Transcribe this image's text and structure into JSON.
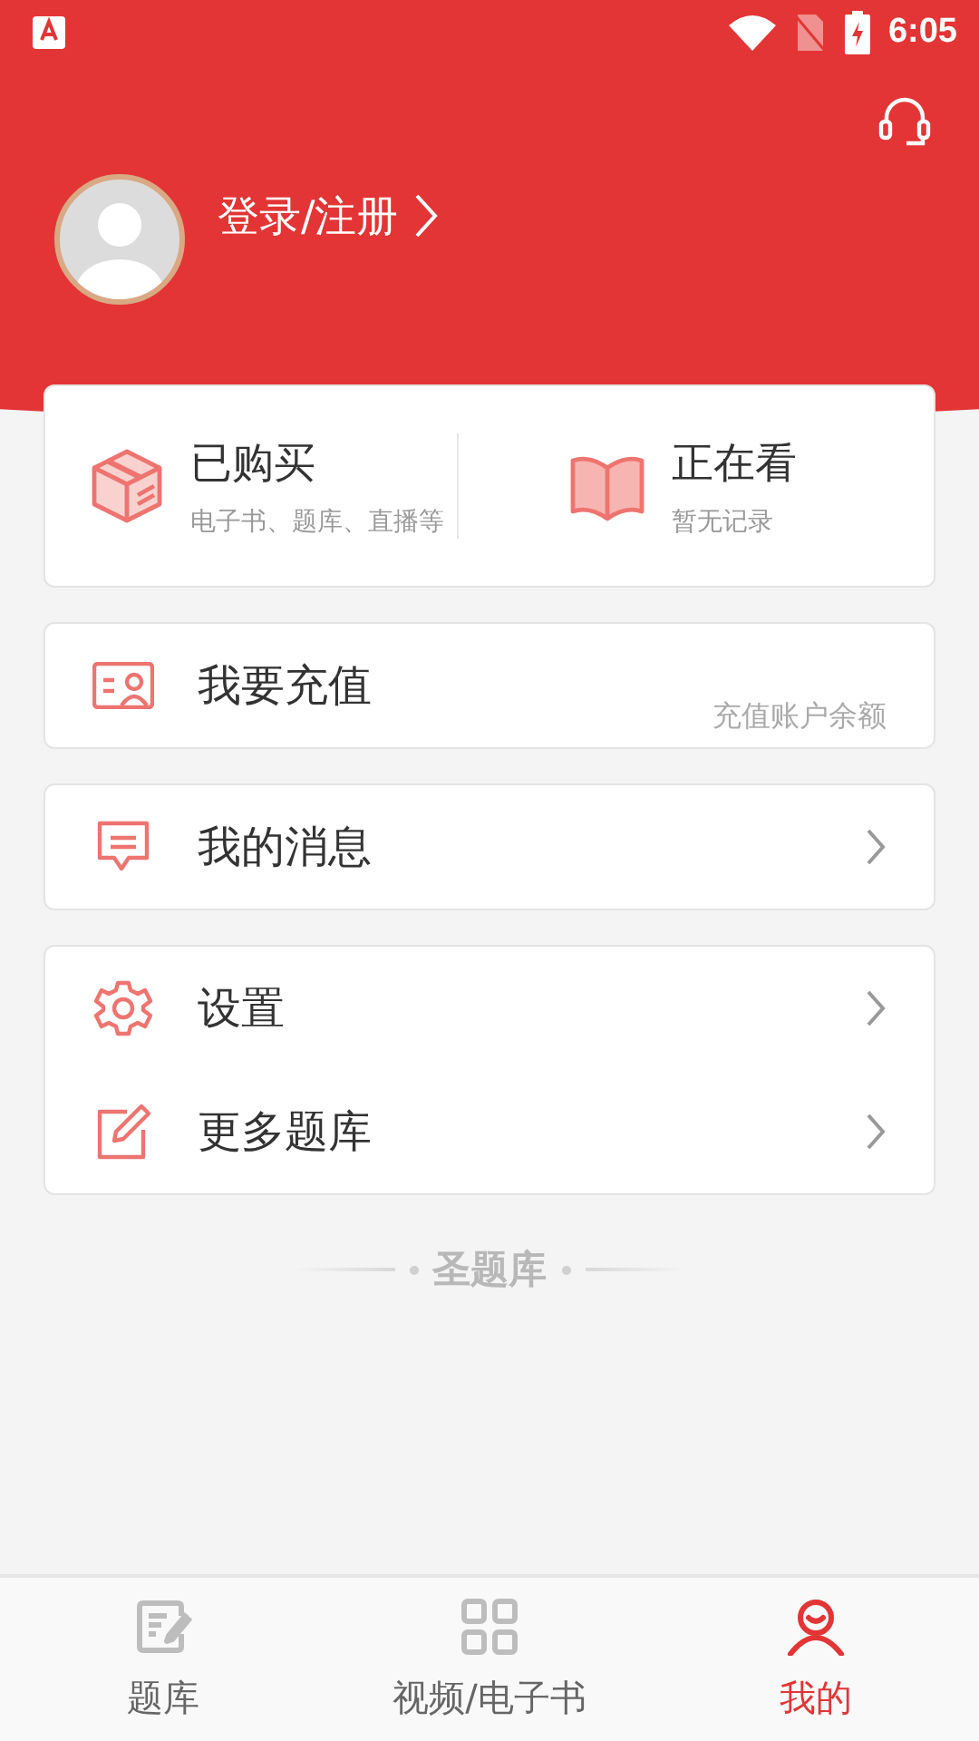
{
  "status_bar": {
    "time": "6:05"
  },
  "profile": {
    "login_link": "登录/注册"
  },
  "summary": [
    {
      "title": "已购买",
      "subtitle": "电子书、题库、直播等"
    },
    {
      "title": "正在看",
      "subtitle": "暂无记录"
    }
  ],
  "menu_groups": [
    [
      {
        "label": "我要充值",
        "hint": "充值账户余额",
        "has_arrow": false
      }
    ],
    [
      {
        "label": "我的消息",
        "has_arrow": true
      }
    ],
    [
      {
        "label": "设置",
        "has_arrow": true
      },
      {
        "label": "更多题库",
        "has_arrow": true
      }
    ]
  ],
  "brand": "圣题库",
  "tabs": [
    {
      "label": "题库",
      "selected": false
    },
    {
      "label": "视频/电子书",
      "selected": false
    },
    {
      "label": "我的",
      "selected": true
    }
  ]
}
